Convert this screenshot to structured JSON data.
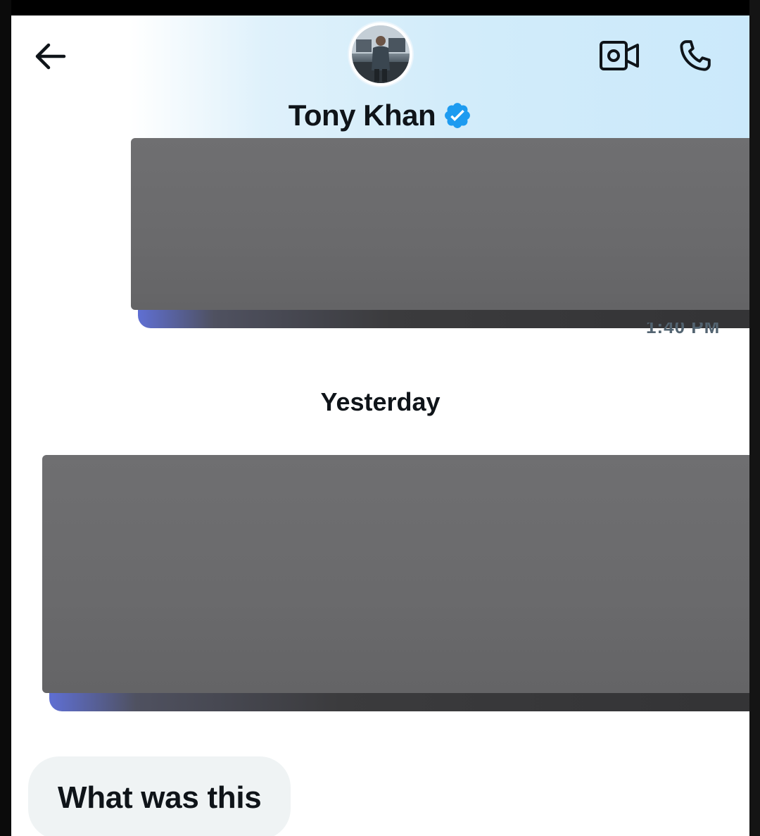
{
  "header": {
    "contact_name": "Tony Khan",
    "verified": true
  },
  "icons": {
    "back": "arrow-left-icon",
    "avatar": "profile-avatar",
    "verified": "verified-badge-icon",
    "video": "video-call-icon",
    "call": "phone-icon"
  },
  "colors": {
    "verified_blue": "#1d9bf0",
    "text_primary": "#0f1419",
    "bubble_bg": "#eff3f4",
    "redaction_gray": "#6c6c6e"
  },
  "messages": {
    "first_timestamp": "1:40 PM",
    "day_divider": "Yesterday",
    "last_message": "What was this"
  }
}
